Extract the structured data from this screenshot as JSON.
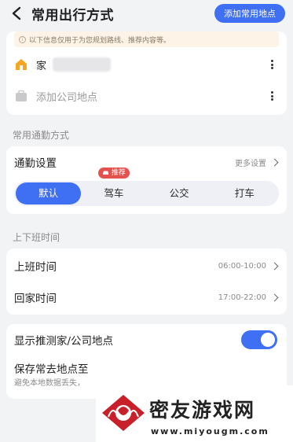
{
  "header": {
    "title": "常用出行方式",
    "add_button": "添加常用地点"
  },
  "places": {
    "notice": "以下信息仅用于为您规划路线、推荐内容等。",
    "home_label": "家",
    "company_label": "添加公司地点"
  },
  "commute": {
    "section_title": "常用通勤方式",
    "settings_label": "通勤设置",
    "more_settings": "更多设置",
    "modes": [
      "默认",
      "驾车",
      "公交",
      "打车"
    ],
    "selected_mode": "默认",
    "recommend_tag": "推荐"
  },
  "work_time": {
    "section_title": "上下班时间",
    "go_to_work_label": "上班时间",
    "go_to_work_value": "06:00-10:00",
    "go_home_label": "回家时间",
    "go_home_value": "17:00-22:00"
  },
  "misc": {
    "show_predicted_label": "显示推测家/公司地点",
    "show_predicted_on": true,
    "save_label": "保存常去地点至",
    "save_sub": "避免本地数据丢失，"
  },
  "watermark": {
    "title": "密友游戏网",
    "url": "www.miyougm.com"
  },
  "colors": {
    "accent": "#3f6ff2",
    "tag": "#e5524e",
    "home_icon": "#f5a623"
  }
}
